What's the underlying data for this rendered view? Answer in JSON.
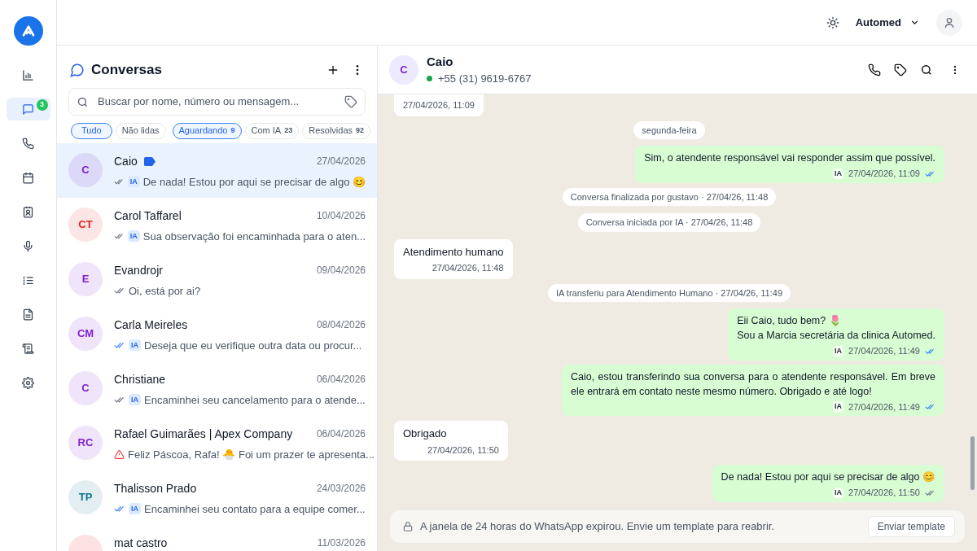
{
  "nav": [
    {
      "kind": "chart",
      "selected": false
    },
    {
      "kind": "chat",
      "selected": true,
      "badge": "3"
    },
    {
      "kind": "phone",
      "selected": false
    },
    {
      "kind": "calendar",
      "selected": false
    },
    {
      "kind": "contact",
      "selected": false
    },
    {
      "kind": "mic",
      "selected": false
    },
    {
      "kind": "list",
      "selected": false
    },
    {
      "kind": "file",
      "selected": false
    },
    {
      "kind": "scroll",
      "selected": false
    },
    {
      "kind": "gear",
      "selected": false
    }
  ],
  "header": {
    "account": "Automed"
  },
  "list": {
    "title": "Conversas",
    "search": {
      "placeholder": "Buscar por nome, número ou mensagem..."
    },
    "filters": [
      {
        "label": "Tudo",
        "selected": true
      },
      {
        "label": "Não lidas",
        "selected": false
      },
      {
        "label": "Aguardando",
        "count": "9",
        "selected": true
      },
      {
        "label": "Com IA",
        "count": "23",
        "selected": false
      },
      {
        "label": "Resolvidas",
        "count": "92",
        "selected": false
      }
    ],
    "conversations": [
      {
        "initials": "C",
        "color": "#7e22ce",
        "name": "Caio",
        "tag": true,
        "date": "27/04/2026",
        "read": false,
        "failed": false,
        "ia": "IA",
        "preview": "De nada! Estou por aqui se precisar de algo 😊",
        "selected": true
      },
      {
        "initials": "CT",
        "color": "#dc2626",
        "name": "Carol Taffarel",
        "tag": false,
        "date": "10/04/2026",
        "read": false,
        "failed": false,
        "ia": "IA",
        "preview": "Sua observação foi encaminhada para o aten...",
        "selected": false
      },
      {
        "initials": "E",
        "color": "#7e22ce",
        "name": "Evandrojr",
        "tag": false,
        "date": "09/04/2026",
        "read": false,
        "failed": false,
        "preview": "Oi, está por ai?",
        "selected": false
      },
      {
        "initials": "CM",
        "color": "#7e22ce",
        "name": "Carla Meireles",
        "tag": false,
        "date": "08/04/2026",
        "read": true,
        "failed": false,
        "ia": "IA",
        "preview": "Deseja que eu verifique outra data ou procur...",
        "selected": false
      },
      {
        "initials": "C",
        "color": "#7e22ce",
        "name": "Christiane",
        "tag": false,
        "date": "06/04/2026",
        "read": false,
        "failed": false,
        "ia": "IA",
        "preview": "Encaminhei seu cancelamento para o atende...",
        "selected": false
      },
      {
        "initials": "RC",
        "color": "#7e22ce",
        "name": "Rafael Guimarães | Apex Company",
        "tag": false,
        "date": "06/04/2026",
        "failed": true,
        "preview": "Feliz Páscoa, Rafa! 🐣 Foi um prazer te apresenta...",
        "selected": false
      },
      {
        "initials": "TP",
        "color": "#0e7490",
        "name": "Thalisson Prado",
        "tag": false,
        "date": "24/03/2026",
        "read": true,
        "failed": false,
        "ia": "IA",
        "preview": "Encaminhei seu contato para a equipe comer...",
        "selected": false
      },
      {
        "name": "mat castro",
        "tag": false,
        "date": "11/03/2026",
        "selected": false
      }
    ]
  },
  "chat": {
    "contact": {
      "initials": "C",
      "name": "Caio",
      "phone": "+55 (31) 9619-6767",
      "online": true
    },
    "messages": [
      {
        "kind": "incoming",
        "time": "27/04/2026, 11:09"
      },
      {
        "kind": "system",
        "text": "segunda-feira"
      },
      {
        "kind": "outgoing",
        "text": "Sim, o atendente responsável vai responder assim que possível.",
        "ia": "IA",
        "time": "27/04/2026, 11:09",
        "read": true
      },
      {
        "kind": "system",
        "text": "Conversa finalizada por gustavo · 27/04/26, 11:48"
      },
      {
        "kind": "system",
        "text": "Conversa iniciada por IA · 27/04/26, 11:48"
      },
      {
        "kind": "incoming",
        "text": "Atendimento humano",
        "time": "27/04/2026, 11:48"
      },
      {
        "kind": "system",
        "text": "IA transferiu para Atendimento Humano · 27/04/26, 11:49"
      },
      {
        "kind": "outgoing",
        "text": "Eii Caio, tudo bem? 🌷\nSou a Marcia secretária da clinica Automed.",
        "ia": "IA",
        "time": "27/04/2026, 11:49",
        "read": true
      },
      {
        "kind": "outgoing",
        "text": "Caio, estou transferindo sua conversa para o atendente responsável. Em breve ele entrará em contato neste mesmo número. Obrigado e até logo!",
        "ia": "IA",
        "time": "27/04/2026, 11:49",
        "read": true
      },
      {
        "kind": "incoming",
        "text": "Obrigado",
        "time": "27/04/2026, 11:50"
      },
      {
        "kind": "outgoing",
        "text": "De nada! Estou por aqui se precisar de algo 😊",
        "ia": "IA",
        "time": "27/04/2026, 11:50",
        "read": false
      }
    ],
    "notice": {
      "text": "A janela de 24 horas do WhatsApp expirou. Envie um template para reabrir.",
      "button": "Enviar template"
    }
  }
}
